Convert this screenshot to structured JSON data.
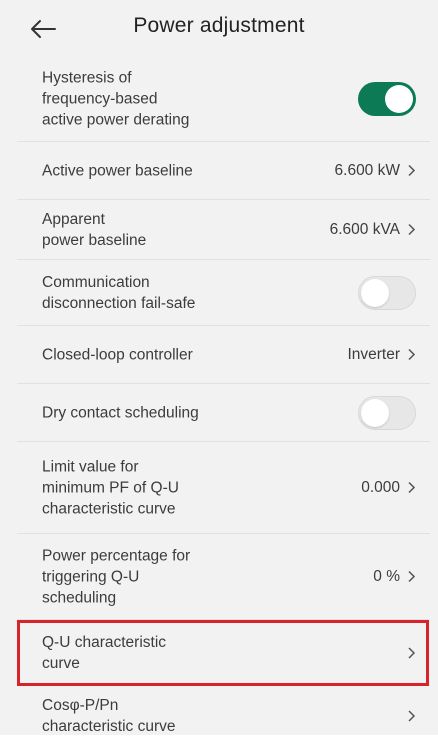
{
  "header": {
    "title": "Power adjustment",
    "back_icon": "arrow-left-icon"
  },
  "settings": [
    {
      "label": "Hysteresis of\nfrequency-based\nactive power derating",
      "control": "toggle",
      "toggle_state": "on"
    },
    {
      "label": "Active power baseline",
      "control": "value",
      "value": "6.600 kW"
    },
    {
      "label": "Apparent\npower baseline",
      "control": "value",
      "value": "6.600 kVA"
    },
    {
      "label": "Communication\ndisconnection fail-safe",
      "control": "toggle",
      "toggle_state": "off"
    },
    {
      "label": "Closed-loop controller",
      "control": "value",
      "value": "Inverter"
    },
    {
      "label": "Dry contact scheduling",
      "control": "toggle",
      "toggle_state": "off"
    },
    {
      "label": "Limit value for\nminimum PF of Q-U\ncharacteristic curve",
      "control": "value",
      "value": "0.000"
    },
    {
      "label": "Power percentage for\ntriggering Q-U\nscheduling",
      "control": "value",
      "value": "0 %"
    },
    {
      "label": "Q-U characteristic\ncurve",
      "control": "chevron",
      "value": "",
      "highlighted": true
    },
    {
      "label": "Cosφ-P/Pn\ncharacteristic curve",
      "control": "chevron",
      "value": ""
    }
  ],
  "colors": {
    "toggle_on": "#0b7a55",
    "toggle_off": "#e7e7e7",
    "highlight": "#d9232a",
    "background": "#f2f2f2"
  }
}
